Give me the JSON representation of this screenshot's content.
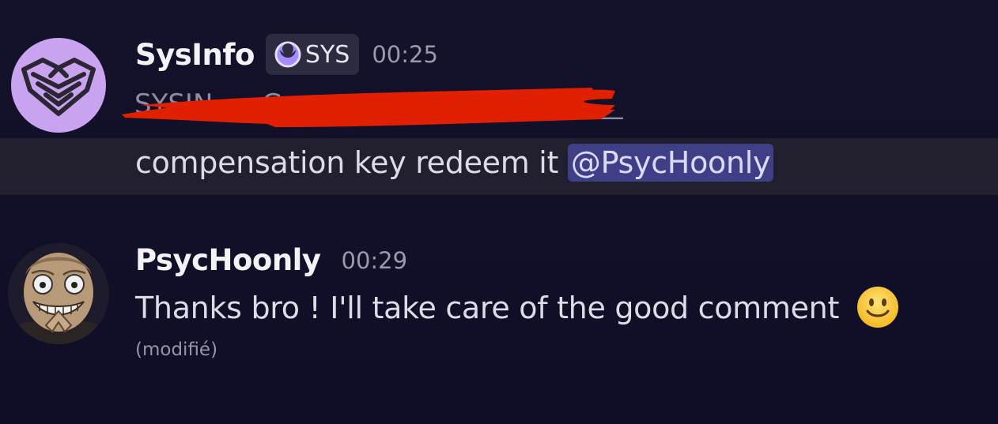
{
  "messages": [
    {
      "author": "SysInfo",
      "tag": {
        "label": "SYS",
        "icon": "crescent-badge-icon",
        "color": "#c9a6ff"
      },
      "timestamp": "00:25",
      "redacted_line": "redacted-text",
      "text": "compensation key redeem it",
      "mention": "@PsycHoonly",
      "avatar": "sysinfo-logo-avatar",
      "avatar_color": "#c9a3ef"
    },
    {
      "author": "PsycHoonly",
      "timestamp": "00:29",
      "text": "Thanks bro ! I'll take care of the good comment",
      "emoji": "slightly-smiling-face-icon",
      "edited": "(modifié)",
      "avatar": "grinning-character-avatar"
    }
  ],
  "colors": {
    "background": "#13122a",
    "mention_bg": "#3e3f86",
    "redaction": "#e02000",
    "highlight_row": "#221f2e"
  }
}
